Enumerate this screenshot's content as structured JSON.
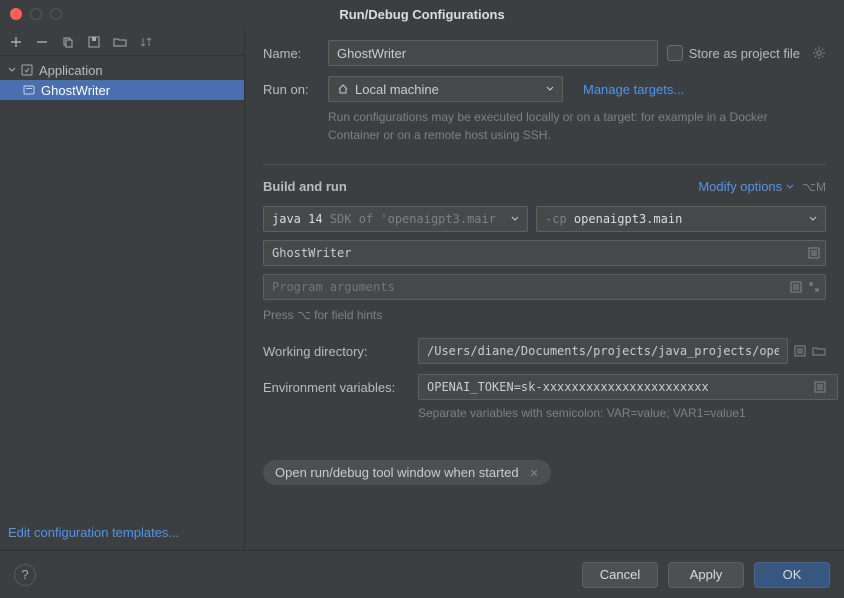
{
  "window": {
    "title": "Run/Debug Configurations"
  },
  "sidebar": {
    "category": "Application",
    "items": [
      {
        "label": "GhostWriter"
      }
    ],
    "edit_templates": "Edit configuration templates..."
  },
  "form": {
    "name_label": "Name:",
    "name_value": "GhostWriter",
    "store_label": "Store as project file",
    "run_on_label": "Run on:",
    "run_on_value": "Local machine",
    "manage_targets": "Manage targets...",
    "run_on_hint": "Run configurations may be executed locally or on a target: for example in a Docker Container or on a remote host using SSH.",
    "build_section": "Build and run",
    "modify_options": "Modify options",
    "modify_shortcut": "⌥M",
    "jdk_prefix": "java 14",
    "jdk_suffix": "SDK of 'openaigpt3.mair",
    "cp_prefix": "-cp",
    "cp_value": "openaigpt3.main",
    "main_class": "GhostWriter",
    "program_args_placeholder": "Program arguments",
    "field_hints": "Press ⌥ for field hints",
    "workdir_label": "Working directory:",
    "workdir_value": "/Users/diane/Documents/projects/java_projects/openai",
    "env_label": "Environment variables:",
    "env_value": "OPENAI_TOKEN=sk-xxxxxxxxxxxxxxxxxxxxxxx",
    "env_hint": "Separate variables with semicolon: VAR=value; VAR1=value1",
    "pill_label": "Open run/debug tool window when started"
  },
  "footer": {
    "cancel": "Cancel",
    "apply": "Apply",
    "ok": "OK"
  }
}
